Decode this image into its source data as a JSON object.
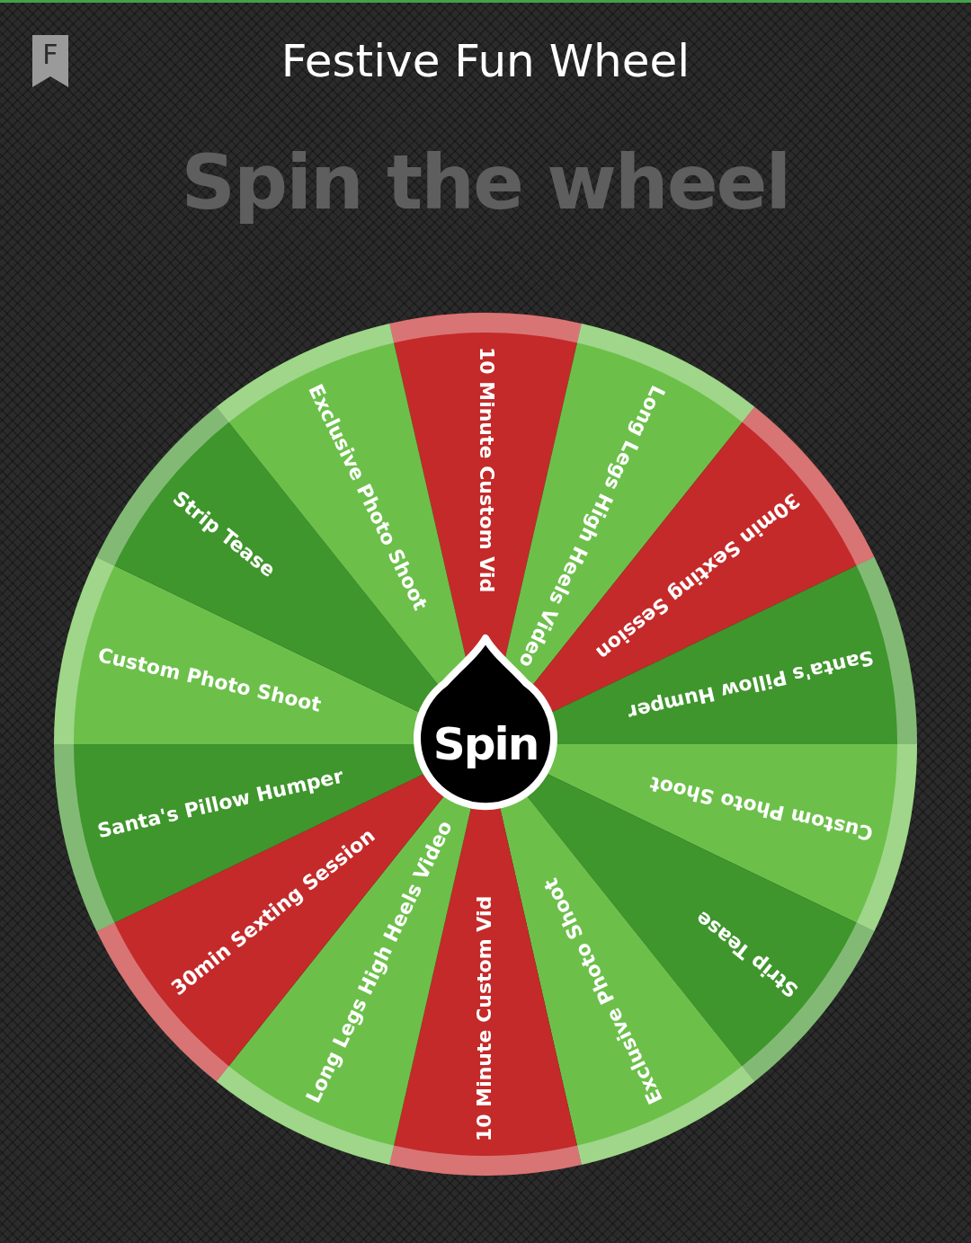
{
  "header": {
    "logo_letter": "F",
    "title": "Festive Fun Wheel"
  },
  "heading": "Spin the wheel",
  "wheel": {
    "spin_label": "Spin",
    "segments": [
      {
        "label": "10 Minute Custom Vid",
        "color": "#c42a2a"
      },
      {
        "label": "Long Legs High Heels Video",
        "color": "#6cc04a"
      },
      {
        "label": "30min Sexting Session",
        "color": "#c42a2a"
      },
      {
        "label": "Santa's Pillow Humper",
        "color": "#3f962c"
      },
      {
        "label": "Custom Photo Shoot",
        "color": "#6cc04a"
      },
      {
        "label": "Strip Tease",
        "color": "#3f962c"
      },
      {
        "label": "Exclusive Photo Shoot",
        "color": "#6cc04a"
      },
      {
        "label": "10 Minute Custom Vid",
        "color": "#c42a2a"
      },
      {
        "label": "Long Legs High Heels Video",
        "color": "#6cc04a"
      },
      {
        "label": "30min Sexting Session",
        "color": "#c42a2a"
      },
      {
        "label": "Santa's Pillow Humper",
        "color": "#3f962c"
      },
      {
        "label": "Custom Photo Shoot",
        "color": "#6cc04a"
      },
      {
        "label": "Strip Tease",
        "color": "#3f962c"
      },
      {
        "label": "Exclusive Photo Shoot",
        "color": "#6cc04a"
      }
    ]
  }
}
